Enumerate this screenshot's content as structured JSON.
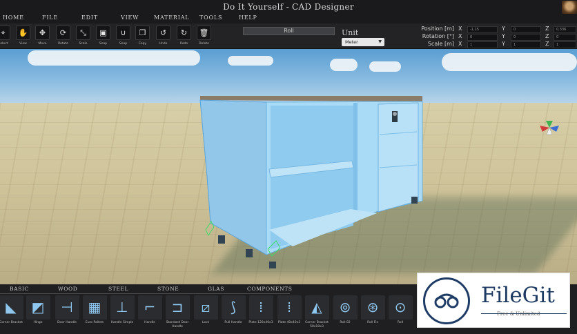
{
  "window": {
    "title": "Do It Yourself - CAD Designer"
  },
  "menu": [
    "HOME",
    "FILE",
    "EDIT",
    "VIEW",
    "MATERIAL",
    "TOOLS",
    "HELP"
  ],
  "toolbar": {
    "tools": [
      {
        "label": "Select",
        "icon": "select-icon",
        "glyph": "⌖"
      },
      {
        "label": "View",
        "icon": "hand-icon",
        "glyph": "✋"
      },
      {
        "label": "Move",
        "icon": "move-icon",
        "glyph": "✥"
      },
      {
        "label": "Rotate",
        "icon": "rotate-icon",
        "glyph": "⟳"
      },
      {
        "label": "Scale",
        "icon": "scale-icon",
        "glyph": "⤡"
      },
      {
        "label": "Snap",
        "icon": "snap-box-icon",
        "glyph": "▣"
      },
      {
        "label": "Snap",
        "icon": "magnet-icon",
        "glyph": "∪"
      },
      {
        "label": "Copy",
        "icon": "copy-icon",
        "glyph": "❐"
      },
      {
        "label": "Undo",
        "icon": "undo-icon",
        "glyph": "↺"
      },
      {
        "label": "Redo",
        "icon": "redo-icon",
        "glyph": "↻"
      },
      {
        "label": "Delete",
        "icon": "trash-icon",
        "glyph": "🗑"
      }
    ],
    "roll_label": "Roll",
    "unit_label": "Unit",
    "unit_value": "Meter"
  },
  "transform": {
    "position_label": "Position [m]",
    "rotation_label": "Rotation [°]",
    "scale_label": "Scale [m]",
    "axes": [
      "X",
      "Y",
      "Z"
    ],
    "position": [
      "-1,15",
      "0",
      "0,336"
    ],
    "rotation": [
      "0",
      "0",
      "0"
    ],
    "scale": [
      "1",
      "1",
      "1"
    ]
  },
  "library": {
    "tabs": [
      "BASIC",
      "WOOD",
      "STEEL",
      "STONE",
      "GLAS",
      "COMPONENTS"
    ],
    "items": [
      "Corner Bracket",
      "Hinge",
      "Door Handle",
      "Euro Pallets",
      "Handle Simple",
      "Handle",
      "Standard Door Handle",
      "Lock",
      "Pull Handle",
      "Plate 120x40x3",
      "Plate 40x40x3",
      "Corner Bracket 50x10x3",
      "Roll 02",
      "Roll Fix",
      "Roll"
    ]
  },
  "watermark": {
    "brand": "FileGit",
    "tagline": "Free & Unlimited"
  },
  "colors": {
    "cabinet": "#a8d8f4",
    "accent_blue": "#1d3a63"
  }
}
